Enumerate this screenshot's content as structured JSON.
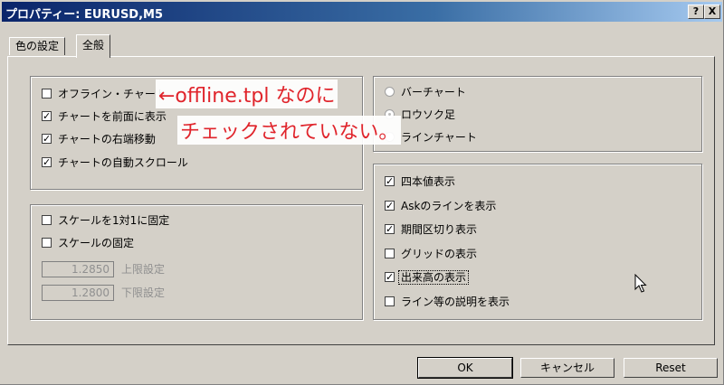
{
  "window": {
    "title": "プロパティー: EURUSD,M5"
  },
  "title_buttons": {
    "help": "?",
    "close": "X"
  },
  "tabs": [
    {
      "label": "色の設定",
      "active": false
    },
    {
      "label": "全般",
      "active": true
    }
  ],
  "chart_options": [
    {
      "label": "オフライン・チャート",
      "checked": false
    },
    {
      "label": "チャートを前面に表示",
      "checked": true
    },
    {
      "label": "チャートの右端移動",
      "checked": true
    },
    {
      "label": "チャートの自動スクロール",
      "checked": true
    }
  ],
  "scale_options": [
    {
      "label": "スケールを1対1に固定",
      "checked": false
    },
    {
      "label": "スケールの固定",
      "checked": false
    }
  ],
  "scale_limits": {
    "upper_value": "1.2850",
    "upper_label": "上限設定",
    "lower_value": "1.2800",
    "lower_label": "下限設定"
  },
  "chart_types": [
    {
      "label": "バーチャート",
      "selected": false
    },
    {
      "label": "ロウソク足",
      "selected": true
    },
    {
      "label": "ラインチャート",
      "selected": false
    }
  ],
  "display_options": [
    {
      "label": "四本値表示",
      "checked": true
    },
    {
      "label": "Askのラインを表示",
      "checked": true
    },
    {
      "label": "期間区切り表示",
      "checked": true
    },
    {
      "label": "グリッドの表示",
      "checked": false
    },
    {
      "label": "出来高の表示",
      "checked": true,
      "focused": true
    },
    {
      "label": "ライン等の説明を表示",
      "checked": false
    }
  ],
  "buttons": {
    "ok": "OK",
    "cancel": "キャンセル",
    "reset": "Reset"
  },
  "annotation": {
    "line1": "←offline.tpl なのに",
    "line2": "チェックされていない。",
    "color": "#e0242b"
  }
}
